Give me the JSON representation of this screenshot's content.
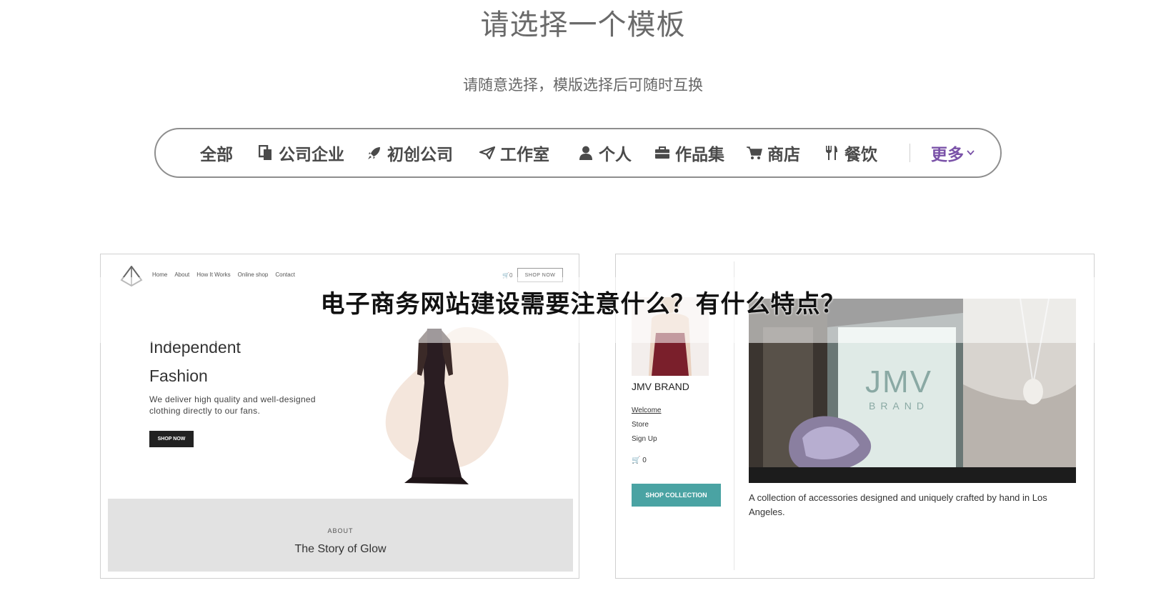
{
  "header": {
    "title": "请选择一个模板",
    "subtitle": "请随意选择，模版选择后可随时互换"
  },
  "filters": {
    "items": [
      {
        "label": "全部",
        "icon": "none"
      },
      {
        "label": "公司企业",
        "icon": "copy-icon"
      },
      {
        "label": "初创公司",
        "icon": "rocket-icon"
      },
      {
        "label": "工作室",
        "icon": "paper-plane-icon"
      },
      {
        "label": "个人",
        "icon": "user-icon"
      },
      {
        "label": "作品集",
        "icon": "briefcase-icon"
      },
      {
        "label": "商店",
        "icon": "cart-icon"
      },
      {
        "label": "餐饮",
        "icon": "cutlery-icon"
      }
    ],
    "more_label": "更多",
    "more_color": "#7a52a8"
  },
  "template_left": {
    "nav": [
      "Home",
      "About",
      "How It Works",
      "Online shop",
      "Contact"
    ],
    "cart_count": "0",
    "shop_now_outline": "SHOP NOW",
    "hero_title_line1": "Independent",
    "hero_title_line2": "Fashion",
    "hero_desc": "We deliver high quality and well-designed clothing directly to our fans.",
    "shop_now_button": "SHOP NOW",
    "about_label": "ABOUT",
    "about_title": "The Story of Glow"
  },
  "template_right": {
    "brand": "JMV BRAND",
    "nav": [
      "Welcome",
      "Store",
      "Sign Up"
    ],
    "cart_count": "0",
    "shop_button": "SHOP COLLECTION",
    "photo_logo_top": "JMV",
    "photo_logo_bottom": "BRAND",
    "caption": "A collection of accessories designed and uniquely crafted by hand in Los Angeles.",
    "accent_color": "#4aa3a3"
  },
  "overlay": {
    "title": "电子商务网站建设需要注意什么？有什么特点？"
  }
}
